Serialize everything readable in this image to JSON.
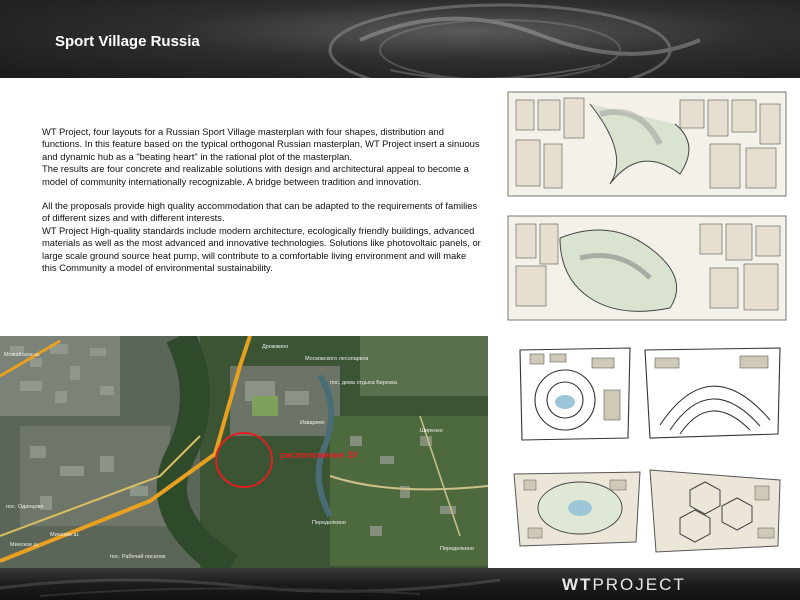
{
  "header": {
    "title": "Sport Village Russia"
  },
  "description": {
    "paragraph1": "WT Project, four layouts for a Russian Sport Village masterplan with four shapes, distribution and functions. In this feature based on the typical orthogonal Russian masterplan, WT Project insert a sinuous and dynamic hub as a \"beating heart\" in the rational plot of the masterplan.\nThe results are four concrete and realizable solutions with design and architectural appeal to become a model of community internationally recognizable. A bridge between tradition and innovation.",
    "paragraph2": "All the proposals provide high quality accommodation that can be adapted to the requirements of families of different sizes and with different interests.\nWT Project High-quality standards include modern architecture, ecologically friendly buildings, advanced materials as well as the most advanced and innovative technologies. Solutions like photovoltaic panels, or large scale ground source heat pump, will contribute to a comfortable living environment and will make this Community a model of environmental sustainability."
  },
  "map": {
    "site_label": "расположение ЗУ",
    "place_labels": [
      "Дрожжино",
      "Московского лесопарков",
      "пос. дома отдыха Березка",
      "Изварино",
      "Ширенко",
      "Переделкино",
      "Переделкино",
      "Минское ш.",
      "Минское ш.",
      "пос. Рабочий поселок",
      "Можайское ш.",
      "пос. Одинцово"
    ]
  },
  "footer": {
    "brand_a": "WT",
    "brand_b": "PROJECT"
  },
  "colors": {
    "header_bg": "#2e2e2e",
    "site_circle": "#e02020",
    "road": "#e8a020",
    "footer_text": "#e8e8e8"
  }
}
